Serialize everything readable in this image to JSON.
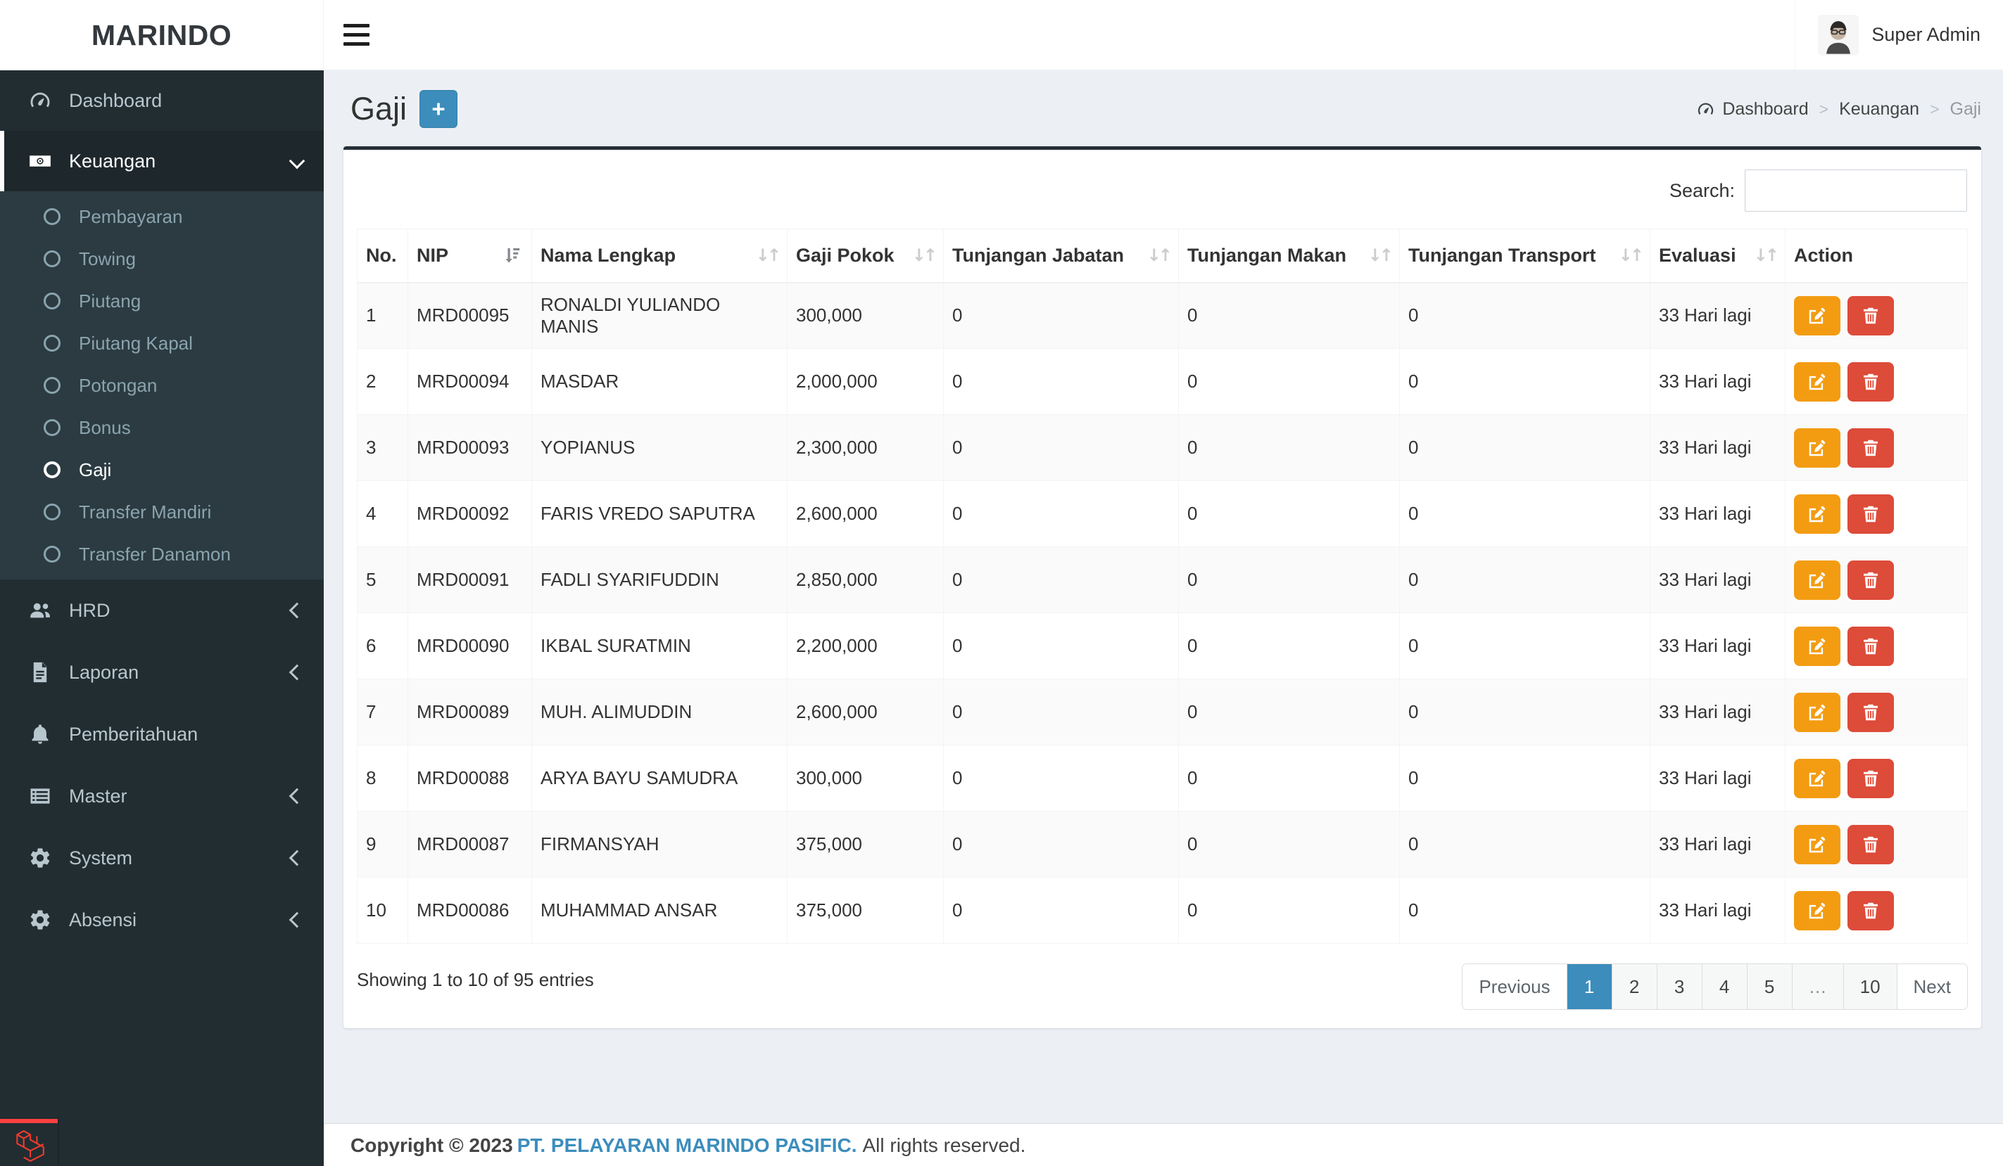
{
  "colors": {
    "accent": "#3c8dbc",
    "warning": "#f39c12",
    "danger": "#dd4b39",
    "sidebar_bg": "#222d32",
    "submenu_bg": "#2c3b41",
    "content_bg": "#ecf0f5",
    "card_top_border": "#272f36",
    "laravel_red": "#ef3b2d"
  },
  "brand": {
    "name": "MARINDO"
  },
  "navbar": {
    "user_name": "Super Admin"
  },
  "sidebar": {
    "dashboard": "Dashboard",
    "keuangan": "Keuangan",
    "keuangan_children": [
      "Pembayaran",
      "Towing",
      "Piutang",
      "Piutang Kapal",
      "Potongan",
      "Bonus",
      "Gaji",
      "Transfer Mandiri",
      "Transfer Danamon"
    ],
    "active_child": "Gaji",
    "hrd": "HRD",
    "laporan": "Laporan",
    "pemberitahuan": "Pemberitahuan",
    "master": "Master",
    "system": "System",
    "absensi": "Absensi"
  },
  "page": {
    "title": "Gaji",
    "add_button": "+"
  },
  "breadcrumb": {
    "items": [
      "Dashboard",
      "Keuangan",
      "Gaji"
    ],
    "separator": ">"
  },
  "search": {
    "label": "Search:",
    "value": ""
  },
  "table": {
    "headers": [
      "No.",
      "NIP",
      "Nama Lengkap",
      "Gaji Pokok",
      "Tunjangan Jabatan",
      "Tunjangan Makan",
      "Tunjangan Transport",
      "Evaluasi",
      "Action"
    ],
    "sorted_by": "NIP",
    "rows": [
      {
        "no": "1",
        "nip": "MRD00095",
        "nama": "RONALDI YULIANDO MANIS",
        "gaji_pokok": "300,000",
        "tunjangan_jabatan": "0",
        "tunjangan_makan": "0",
        "tunjangan_transport": "0",
        "evaluasi": "33 Hari lagi"
      },
      {
        "no": "2",
        "nip": "MRD00094",
        "nama": "MASDAR",
        "gaji_pokok": "2,000,000",
        "tunjangan_jabatan": "0",
        "tunjangan_makan": "0",
        "tunjangan_transport": "0",
        "evaluasi": "33 Hari lagi"
      },
      {
        "no": "3",
        "nip": "MRD00093",
        "nama": "YOPIANUS",
        "gaji_pokok": "2,300,000",
        "tunjangan_jabatan": "0",
        "tunjangan_makan": "0",
        "tunjangan_transport": "0",
        "evaluasi": "33 Hari lagi"
      },
      {
        "no": "4",
        "nip": "MRD00092",
        "nama": "FARIS VREDO SAPUTRA",
        "gaji_pokok": "2,600,000",
        "tunjangan_jabatan": "0",
        "tunjangan_makan": "0",
        "tunjangan_transport": "0",
        "evaluasi": "33 Hari lagi"
      },
      {
        "no": "5",
        "nip": "MRD00091",
        "nama": "FADLI SYARIFUDDIN",
        "gaji_pokok": "2,850,000",
        "tunjangan_jabatan": "0",
        "tunjangan_makan": "0",
        "tunjangan_transport": "0",
        "evaluasi": "33 Hari lagi"
      },
      {
        "no": "6",
        "nip": "MRD00090",
        "nama": "IKBAL SURATMIN",
        "gaji_pokok": "2,200,000",
        "tunjangan_jabatan": "0",
        "tunjangan_makan": "0",
        "tunjangan_transport": "0",
        "evaluasi": "33 Hari lagi"
      },
      {
        "no": "7",
        "nip": "MRD00089",
        "nama": "MUH. ALIMUDDIN",
        "gaji_pokok": "2,600,000",
        "tunjangan_jabatan": "0",
        "tunjangan_makan": "0",
        "tunjangan_transport": "0",
        "evaluasi": "33 Hari lagi"
      },
      {
        "no": "8",
        "nip": "MRD00088",
        "nama": "ARYA BAYU SAMUDRA",
        "gaji_pokok": "300,000",
        "tunjangan_jabatan": "0",
        "tunjangan_makan": "0",
        "tunjangan_transport": "0",
        "evaluasi": "33 Hari lagi"
      },
      {
        "no": "9",
        "nip": "MRD00087",
        "nama": "FIRMANSYAH",
        "gaji_pokok": "375,000",
        "tunjangan_jabatan": "0",
        "tunjangan_makan": "0",
        "tunjangan_transport": "0",
        "evaluasi": "33 Hari lagi"
      },
      {
        "no": "10",
        "nip": "MRD00086",
        "nama": "MUHAMMAD ANSAR",
        "gaji_pokok": "375,000",
        "tunjangan_jabatan": "0",
        "tunjangan_makan": "0",
        "tunjangan_transport": "0",
        "evaluasi": "33 Hari lagi"
      }
    ]
  },
  "table_footer": {
    "info": "Showing 1 to 10 of 95 entries"
  },
  "pagination": {
    "items": [
      "Previous",
      "1",
      "2",
      "3",
      "4",
      "5",
      "…",
      "10",
      "Next"
    ],
    "active": "1"
  },
  "footer": {
    "copyright": "Copyright © 2023",
    "company": "PT. PELAYARAN MARINDO PASIFIC.",
    "rights": "All rights reserved."
  }
}
